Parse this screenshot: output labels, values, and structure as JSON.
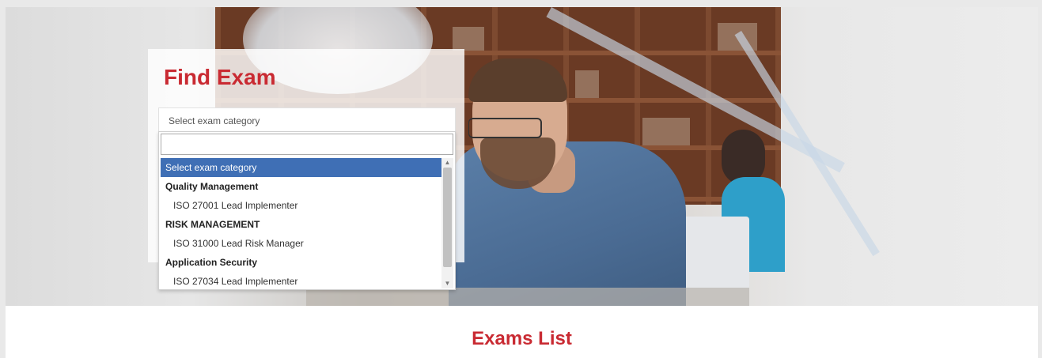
{
  "find_exam": {
    "title": "Find Exam",
    "select_value": "Select exam category",
    "search_value": ""
  },
  "dropdown": {
    "options": [
      {
        "label": "Select exam category",
        "kind": "placeholder",
        "selected": true
      },
      {
        "label": "Quality Management",
        "kind": "group"
      },
      {
        "label": "ISO 27001 Lead Implementer",
        "kind": "option"
      },
      {
        "label": "RISK MANAGEMENT",
        "kind": "group"
      },
      {
        "label": "ISO 31000 Lead Risk Manager",
        "kind": "option"
      },
      {
        "label": "Application Security",
        "kind": "group"
      },
      {
        "label": "ISO 27034 Lead Implementer",
        "kind": "option"
      }
    ],
    "scroll_up_icon": "triangle-up-icon",
    "scroll_down_icon": "triangle-down-icon"
  },
  "exams_list": {
    "title": "Exams List"
  },
  "colors": {
    "accent": "#c92a32",
    "selected_bg": "#3f6fb5"
  }
}
